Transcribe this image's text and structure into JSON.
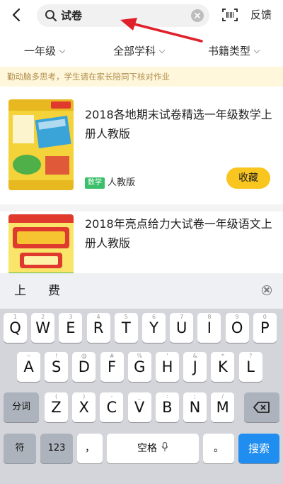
{
  "header": {
    "search_value": "试卷",
    "feedback_label": "反馈"
  },
  "filters": {
    "grade": "一年级",
    "subject": "全部学科",
    "book_type": "书籍类型"
  },
  "notice": "勤动脑多思考，学生请在家长陪同下核对作业",
  "books": [
    {
      "title": "2018各地期末试卷精选一年级数学上册人教版",
      "tag": "数学",
      "publisher": "人教版",
      "fav_label": "收藏"
    },
    {
      "title": "2018年亮点给力大试卷一年级语文上册人教版"
    }
  ],
  "keyboard": {
    "candidates": [
      "上",
      "费"
    ],
    "row1": [
      {
        "k": "Q",
        "s": "1"
      },
      {
        "k": "W",
        "s": "2"
      },
      {
        "k": "E",
        "s": "3"
      },
      {
        "k": "R",
        "s": "4"
      },
      {
        "k": "T",
        "s": "5"
      },
      {
        "k": "Y",
        "s": "6"
      },
      {
        "k": "U",
        "s": "7"
      },
      {
        "k": "I",
        "s": "8"
      },
      {
        "k": "O",
        "s": "9"
      },
      {
        "k": "P",
        "s": "0"
      }
    ],
    "row2": [
      {
        "k": "A",
        "s": "~"
      },
      {
        "k": "S",
        "s": "!"
      },
      {
        "k": "D",
        "s": "@"
      },
      {
        "k": "F",
        "s": "#"
      },
      {
        "k": "G",
        "s": "%"
      },
      {
        "k": "H",
        "s": "'"
      },
      {
        "k": "J",
        "s": "&"
      },
      {
        "k": "K",
        "s": "*"
      },
      {
        "k": "L",
        "s": "?"
      }
    ],
    "row3": [
      {
        "k": "Z",
        "s": "("
      },
      {
        "k": "X",
        "s": ")"
      },
      {
        "k": "C",
        "s": "-"
      },
      {
        "k": "V",
        "s": "_"
      },
      {
        "k": "B",
        "s": ":"
      },
      {
        "k": "N",
        "s": ";"
      },
      {
        "k": "M",
        "s": "/"
      }
    ],
    "fenci_label": "分词",
    "symbols_label": "符",
    "numbers_label": "123",
    "comma_label": "，",
    "space_label": "空格",
    "period_label": "。",
    "search_label": "搜索"
  }
}
